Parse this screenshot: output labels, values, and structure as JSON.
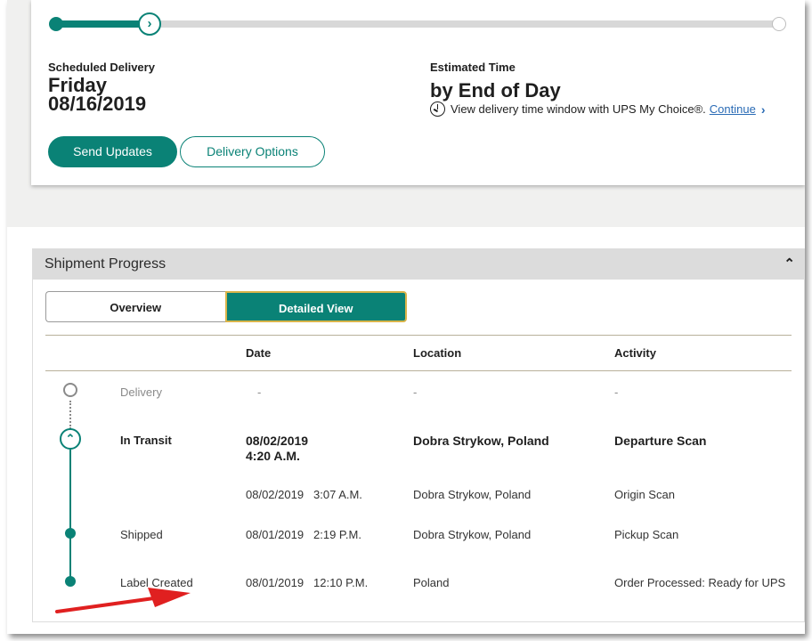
{
  "colors": {
    "accent": "#0a8276",
    "link": "#2a6bb5",
    "annotation_arrow": "#e02020"
  },
  "progress": {
    "fraction": 0.13,
    "current_icon": "chevron-right-icon"
  },
  "delivery": {
    "scheduled_label": "Scheduled Delivery",
    "day": "Friday",
    "date": "08/16/2019",
    "estimated_label": "Estimated Time",
    "estimated_value": "by End of Day",
    "mychoice_text": "View delivery time window with UPS My Choice®.",
    "continue_link": "Continue",
    "send_updates": "Send Updates",
    "delivery_options": "Delivery Options"
  },
  "shipment": {
    "title": "Shipment Progress",
    "tabs": {
      "overview": "Overview",
      "detailed": "Detailed View",
      "selected": "Detailed View"
    },
    "columns": {
      "date": "Date",
      "location": "Location",
      "activity": "Activity"
    },
    "rows": [
      {
        "status": "Delivery",
        "date": "-",
        "time": "",
        "location": "-",
        "activity": "-"
      },
      {
        "status": "In Transit",
        "date": "08/02/2019",
        "time": "4:20 A.M.",
        "location": "Dobra Strykow, Poland",
        "activity": "Departure Scan"
      },
      {
        "status": "",
        "date": "08/02/2019",
        "time": "3:07 A.M.",
        "location": "Dobra Strykow, Poland",
        "activity": "Origin Scan"
      },
      {
        "status": "Shipped",
        "date": "08/01/2019",
        "time": "2:19 P.M.",
        "location": "Dobra Strykow, Poland",
        "activity": "Pickup Scan"
      },
      {
        "status": "Label Created",
        "date": "08/01/2019",
        "time": "12:10 P.M.",
        "location": "Poland",
        "activity": "Order Processed: Ready for UPS"
      }
    ]
  }
}
